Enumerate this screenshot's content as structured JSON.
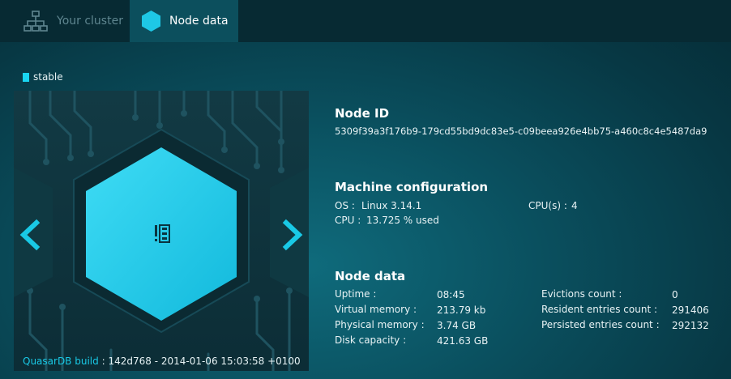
{
  "tabs": {
    "cluster_label": "Your cluster",
    "node_label": "Node data"
  },
  "status": {
    "label": "stable",
    "color": "#19d6f2"
  },
  "build": {
    "label": "QuasarDB build",
    "separator": ":",
    "value": "142d768 - 2014-01-06 15:03:58 +0100"
  },
  "node_id": {
    "title": "Node ID",
    "value": "5309f39a3f176b9-179cd55bd9dc83e5-c09beea926e4bb75-a460c8c4e5487da9"
  },
  "machine": {
    "title": "Machine configuration",
    "os_label": "OS :",
    "os_value": "Linux 3.14.1",
    "cpu_label": "CPU :",
    "cpu_value": "13.725 % used",
    "cpus_label": "CPU(s) :",
    "cpus_value": "4"
  },
  "node_data": {
    "title": "Node data",
    "left": [
      {
        "label": "Uptime :",
        "value": "08:45"
      },
      {
        "label": "Virtual memory :",
        "value": "213.79 kb"
      },
      {
        "label": "Physical memory :",
        "value": "3.74 GB"
      },
      {
        "label": "Disk capacity :",
        "value": "421.63 GB"
      }
    ],
    "right": [
      {
        "label": "Evictions count :",
        "value": "0"
      },
      {
        "label": "Resident entries count :",
        "value": "291406"
      },
      {
        "label": "Persisted entries count :",
        "value": "292132"
      }
    ]
  },
  "icons": {
    "cluster": "network-tree-icon",
    "node": "hexagon-icon",
    "prev": "chevron-left-icon",
    "next": "chevron-right-icon",
    "center": "server-stack-icon"
  },
  "colors": {
    "accent": "#19d6f2",
    "hexagon": "#1ec8e6"
  }
}
